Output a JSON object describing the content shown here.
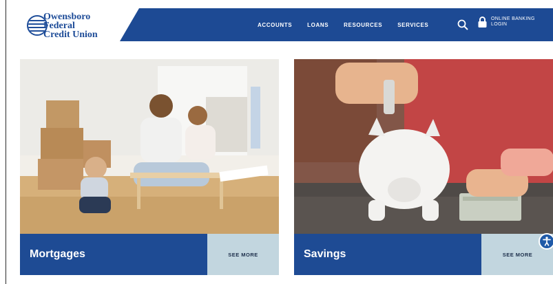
{
  "logo": {
    "line1": "Owensboro",
    "line2": "Federal",
    "line3": "Credit Union"
  },
  "nav": {
    "items": [
      {
        "label": "ACCOUNTS"
      },
      {
        "label": "LOANS"
      },
      {
        "label": "RESOURCES"
      },
      {
        "label": "SERVICES"
      }
    ],
    "search_icon": "search-icon",
    "login_label": "ONLINE BANKING LOGIN",
    "login_icon": "lock-icon"
  },
  "cards": [
    {
      "label": "Mortgages",
      "see_more": "SEE MORE"
    },
    {
      "label": "Savings",
      "see_more": "SEE MORE"
    }
  ],
  "accessibility_icon": "accessibility-icon",
  "colors": {
    "brand_blue": "#1d4a94",
    "see_more_bg": "#c2d6df"
  }
}
